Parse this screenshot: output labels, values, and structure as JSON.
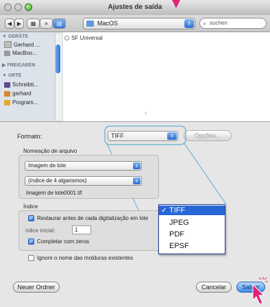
{
  "window": {
    "title": "Ajustes de saída"
  },
  "toolbar": {
    "location": "MacOS",
    "search_placeholder": "suchen"
  },
  "sidebar": {
    "sections": [
      {
        "label": "▼ GERÄTE",
        "items": [
          "Gerhard ...",
          "MacBoo..."
        ]
      },
      {
        "label": "▶ FREIGABEN",
        "items": []
      },
      {
        "label": "▼ ORTE",
        "items": [
          "Schreibti...",
          "gerhard",
          "Program..."
        ]
      }
    ]
  },
  "browser": {
    "first_column_item": "SF Universal"
  },
  "format": {
    "label": "Formato:",
    "value": "TIFF",
    "options_button": "Opções..."
  },
  "naming": {
    "title": "Nomeação de arquivo",
    "pattern": "Imagem de lote",
    "counter": "(índice de 4 algarismos)",
    "example": "Imagem de lote0001.tif"
  },
  "index": {
    "title": "Índice",
    "restore_label": "Restaurar antes de cada digitalização em lote",
    "start_label": "ndice inicial:",
    "start_value": "1",
    "zeros_label": "Completar com zeros"
  },
  "ignore_label": "Ignore o nome das molduras existentes",
  "buttons": {
    "new_folder": "Neuer Ordner",
    "cancel": "Cancelar",
    "save": "Salvar"
  },
  "menu": {
    "items": [
      "TIFF",
      "JPEG",
      "PDF",
      "EPSF"
    ],
    "selected": "TIFF",
    "check": "✓"
  },
  "colors": {
    "accent": "#2767d6",
    "callout": "#3aa3c8",
    "cursor": "#e0237a"
  }
}
